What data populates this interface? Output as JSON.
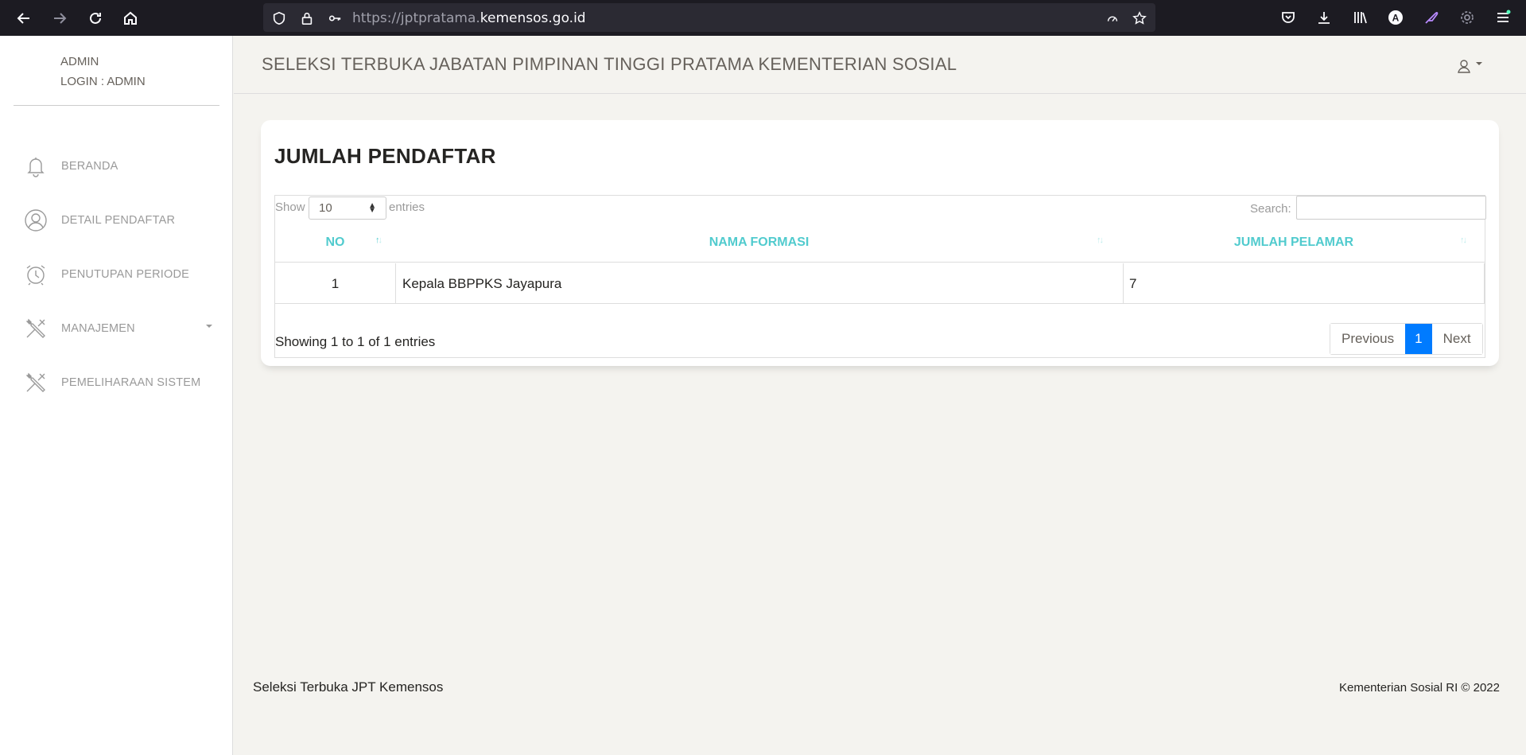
{
  "browser": {
    "url_prefix": "https://jptpratama.",
    "url_host": "kemensos.go.id",
    "profile_letter": "A"
  },
  "sidebar": {
    "user_name": "ADMIN",
    "login_text": "LOGIN : ADMIN",
    "items": [
      {
        "label": "BERANDA",
        "icon": "bell-icon"
      },
      {
        "label": "DETAIL PENDAFTAR",
        "icon": "user-circle-icon"
      },
      {
        "label": "PENUTUPAN PERIODE",
        "icon": "alarm-clock-icon"
      },
      {
        "label": "MANAJEMEN",
        "icon": "tools-icon",
        "has_dropdown": true
      },
      {
        "label": "PEMELIHARAAN SISTEM",
        "icon": "tools-icon"
      }
    ]
  },
  "header": {
    "title": "SELEKSI TERBUKA JABATAN PIMPINAN TINGGI PRATAMA KEMENTERIAN SOSIAL"
  },
  "card": {
    "title": "JUMLAH PENDAFTAR",
    "show_label": "Show",
    "show_value": "10",
    "entries_label": "entries",
    "search_label": "Search:",
    "search_value": "",
    "columns": [
      "NO",
      "NAMA FORMASI",
      "JUMLAH PELAMAR"
    ],
    "rows": [
      {
        "no": "1",
        "nama_formasi": "Kepala BBPPKS Jayapura",
        "jumlah_pelamar": "7"
      }
    ],
    "info": "Showing 1 to 1 of 1 entries",
    "pagination": {
      "previous": "Previous",
      "current": "1",
      "next": "Next"
    }
  },
  "footer": {
    "left": "Seleksi Terbuka JPT Kemensos",
    "right": "Kementerian Sosial RI © 2022"
  },
  "colors": {
    "accent": "#51cbce",
    "pagination_active": "#007bff",
    "browser_dark": "#1c1b22"
  }
}
